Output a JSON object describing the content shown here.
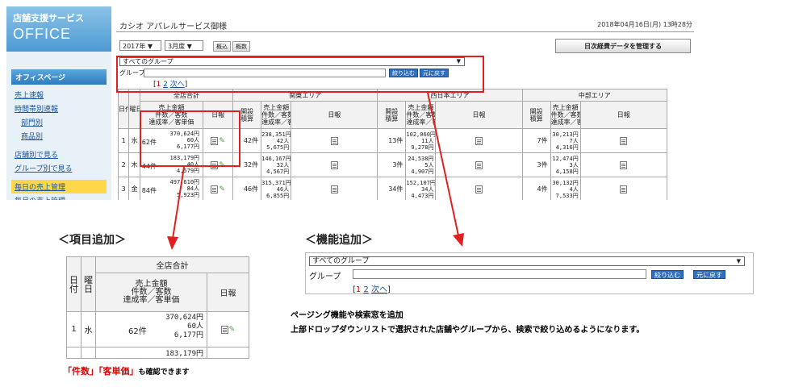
{
  "sidebar": {
    "brand_line1": "店舗支援サービス",
    "brand_line2": "OFFICE",
    "section": "オフィスページ",
    "items": [
      {
        "label": "売上速報",
        "sub": false,
        "active": false,
        "gap": false
      },
      {
        "label": "時間帯別速報",
        "sub": false,
        "active": false,
        "gap": false
      },
      {
        "label": "部門別",
        "sub": true,
        "active": false,
        "gap": false
      },
      {
        "label": "商品別",
        "sub": true,
        "active": false,
        "gap": false
      },
      {
        "label": "店舗別で見る",
        "sub": false,
        "active": false,
        "gap": true
      },
      {
        "label": "グループ別で見る",
        "sub": false,
        "active": false,
        "gap": false
      },
      {
        "label": "毎日の売上管理",
        "sub": false,
        "active": true,
        "gap": true
      },
      {
        "label": "毎月の売上管理",
        "sub": false,
        "active": false,
        "gap": false
      }
    ]
  },
  "header": {
    "company": "カシオ アパレルサービス御様",
    "datetime": "2018年04月16日(月) 13時28分",
    "year": "2017年 ▼",
    "month": "3月度 ▼",
    "btn_summary": "概込",
    "btn_detail": "概数",
    "manage_button": "日次経費データを管理する"
  },
  "filter": {
    "group_select": "すべてのグループ",
    "group_label": "グループ",
    "search_button": "絞り込む",
    "reset_button": "元に戻す",
    "pager_open": "[",
    "pager_current": "1",
    "pager_page2": "2",
    "pager_next": "次へ",
    "pager_close": "]"
  },
  "table": {
    "col_date": "日付",
    "col_weekday": "曜日",
    "areas": [
      "全店合計",
      "関東エリア",
      "西日本エリア",
      "中部エリア"
    ],
    "col_visitors": "開設\n積算",
    "col_sales": "売上金額\n件数／客数\n達成率／客単価",
    "col_report": "日報",
    "rows": [
      {
        "day": "1",
        "weekday": "水",
        "cells": [
          {
            "count": "62件",
            "amounts": "370,624円\n60人\n6,177円"
          },
          {
            "count": "42件",
            "amounts": "238,351円\n42人\n5,675円"
          },
          {
            "count": "13件",
            "amounts": "102,060円\n11人\n9,278円"
          },
          {
            "count": "7件",
            "amounts": "30,213円\n7人\n4,316円"
          }
        ]
      },
      {
        "day": "2",
        "weekday": "木",
        "cells": [
          {
            "count": "44件",
            "amounts": "183,179円\n40人\n4,579円"
          },
          {
            "count": "32件",
            "amounts": "146,167円\n32人\n4,567円"
          },
          {
            "count": "3件",
            "amounts": "24,538円\n5人\n4,907円"
          },
          {
            "count": "3件",
            "amounts": "12,474円\n3人\n4,158円"
          }
        ]
      },
      {
        "day": "3",
        "weekday": "金",
        "cells": [
          {
            "count": "84件",
            "amounts": "497,610円\n84人\n5,923円"
          },
          {
            "count": "46件",
            "amounts": "315,371円\n46人\n6,855円"
          },
          {
            "count": "34件",
            "amounts": "152,107円\n34人\n4,473円"
          },
          {
            "count": "4件",
            "amounts": "30,132円\n4人\n7,533円"
          }
        ]
      }
    ]
  },
  "captions": {
    "item_add": "＜項目追加＞",
    "feature_add": "＜機能追加＞",
    "desc_line1": "ページング機能や検索窓を追加",
    "desc_line2": "上部ドロップダウンリストで選択された店舗やグループから、検索で絞り込めるようになります。",
    "note_part1": "「件数」「客単価」",
    "note_part2": "も確認できます"
  },
  "zoom": {
    "area": "全店合計",
    "row1_amounts": "370,624円\n60人\n6,177円",
    "row1_count": "62件",
    "row2_amount": "183,179円"
  },
  "colors": {
    "highlight_red": "#e02020",
    "link_blue": "#1a56a0",
    "button_blue": "#2f6fc0",
    "active_yellow": "#ffd84a"
  }
}
